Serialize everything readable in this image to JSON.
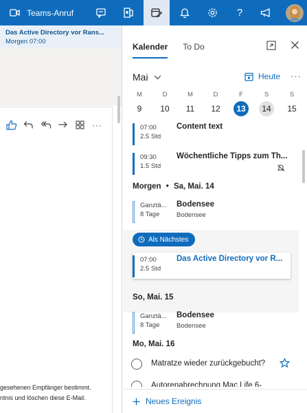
{
  "topbar": {
    "teams_label": "Teams-Anruf",
    "icons": [
      "video-icon",
      "chat-icon",
      "office-icon",
      "calendar-edit-icon",
      "bell-icon",
      "gear-icon",
      "help-icon",
      "megaphone-icon",
      "avatar"
    ],
    "accent": "#0f6cbd"
  },
  "mail": {
    "reminder_title": "Das Active Directory vor Rans...",
    "reminder_time": "Morgen 07:00",
    "footer_line1": "gesehenen Empfänger bestimmt.",
    "footer_line2": "ntnis und löschen diese E-Mail."
  },
  "panel": {
    "tab_calendar": "Kalender",
    "tab_todo": "To Do",
    "month": "Mai",
    "today_label": "Heute",
    "week": [
      {
        "day": "M",
        "date": "9"
      },
      {
        "day": "D",
        "date": "10"
      },
      {
        "day": "M",
        "date": "11"
      },
      {
        "day": "D",
        "date": "12"
      },
      {
        "day": "F",
        "date": "13"
      },
      {
        "day": "S",
        "date": "14"
      },
      {
        "day": "S",
        "date": "15"
      }
    ],
    "selected_date": "13",
    "today_date": "14"
  },
  "agenda": {
    "events_today": [
      {
        "time": "07:00",
        "duration": "2.5 Std",
        "title": "Content text"
      },
      {
        "time": "09:30",
        "duration": "1.5 Std",
        "title": "Wöchentliche Tipps zum Th..."
      }
    ],
    "day_tomorrow": "Morgen",
    "day_tomorrow_date": "Sa, Mai. 14",
    "event_sat": {
      "time": "Ganztä...",
      "duration": "8 Tage",
      "title": "Bodensee",
      "location": "Bodensee"
    },
    "next_label": "Als Nächstes",
    "next_event": {
      "time": "07:00",
      "duration": "2.5 Std",
      "title": "Das Active Directory vor R..."
    },
    "day_sun": "So, Mai. 15",
    "event_sun": {
      "time": "Ganztä...",
      "duration": "8 Tage",
      "title": "Bodensee",
      "location": "Bodensee"
    },
    "day_mon": "Mo, Mai. 16",
    "todos": [
      "Matratze wieder zurückgebucht?",
      "Autorenabrechnung Mac Life 6-"
    ]
  },
  "new_event_label": "Neues Ereignis"
}
